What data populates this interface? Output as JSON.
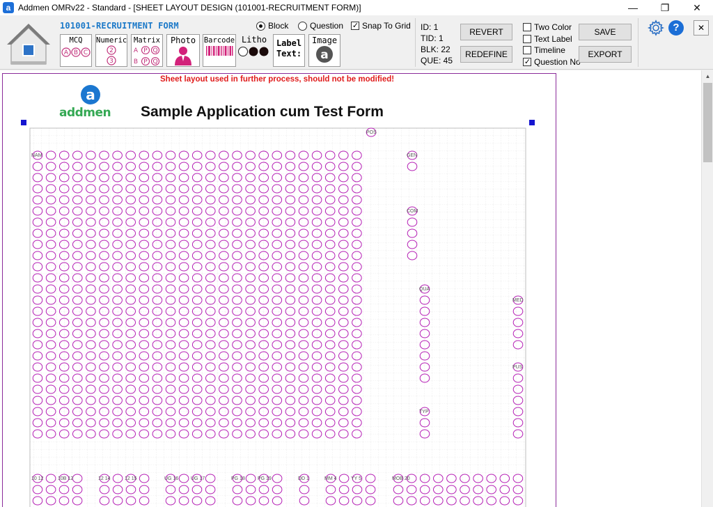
{
  "window": {
    "title": "Addmen OMRv22 - Standard - [SHEET LAYOUT DESIGN (101001-RECRUITMENT FORM)]",
    "app_icon_letter": "a"
  },
  "toolbar": {
    "form_name": "101001-RECRUITMENT FORM",
    "tools": {
      "mcq": "MCQ",
      "numeric": "Numeric",
      "matrix": "Matrix",
      "photo": "Photo",
      "barcode": "Barcode",
      "barcode_digits": "1 1 2 3",
      "litho": "Litho",
      "label_text_1": "Label",
      "label_text_2": "Text:",
      "image": "Image"
    },
    "mcq_letters": [
      "A",
      "B",
      "C"
    ],
    "numeric_digits": [
      "2",
      "3"
    ],
    "matrix_letters": [
      "A",
      "P",
      "Q",
      "B",
      "P",
      "Q"
    ],
    "mode": {
      "block_label": "Block",
      "question_label": "Question",
      "selected": "Block",
      "snap_label": "Snap To Grid",
      "snap_checked": true
    },
    "info": {
      "id": "ID: 1",
      "tid": "TID: 1",
      "blk": "BLK: 22",
      "que": "QUE: 45"
    },
    "buttons": {
      "revert": "REVERT",
      "redefine": "REDEFINE",
      "save": "SAVE",
      "export": "EXPORT"
    },
    "options": [
      {
        "label": "Two Color",
        "checked": false
      },
      {
        "label": "Text Label",
        "checked": false
      },
      {
        "label": "Timeline",
        "checked": false
      },
      {
        "label": "Question No",
        "checked": true
      }
    ],
    "help_glyph": "?",
    "close_glyph": "✕"
  },
  "sheet": {
    "warning": "Sheet layout used in further process, should not be modified!",
    "title": "Sample Application cum Test Form",
    "logo_text": "addmen",
    "logo_letter": "a",
    "block_labels": {
      "pos": "POS",
      "nam": "NAM",
      "gen": "GEN",
      "com": "COM",
      "qua": "QUA",
      "med": "MED",
      "pus": "PUS",
      "typ": "TYP"
    },
    "bottom_labels": [
      "10  12",
      "10B 12",
      "12  14",
      "12  15",
      "UG  16",
      "UG  17",
      "PG  18",
      "PG  19",
      "DD  1",
      "MM  4",
      "YY  5",
      "MOB 20"
    ],
    "accent": "#b51fb5"
  },
  "window_controls": {
    "minimize": "—",
    "restore": "❐",
    "close": "✕"
  }
}
